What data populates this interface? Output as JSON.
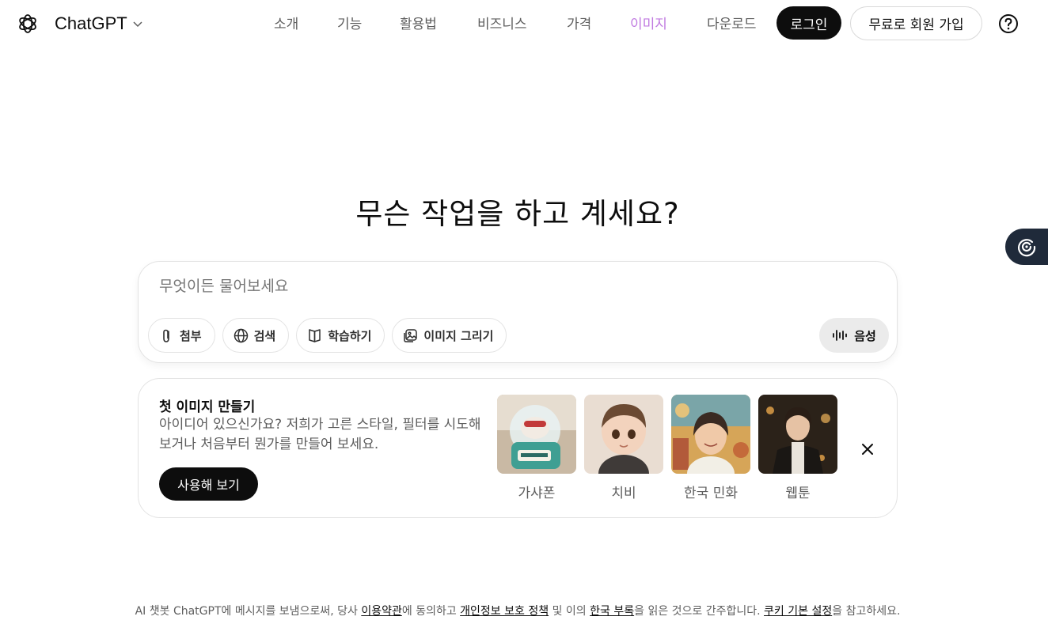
{
  "header": {
    "brand": "ChatGPT",
    "nav": [
      "소개",
      "기능",
      "활용법",
      "비즈니스",
      "가격",
      "이미지",
      "다운로드"
    ],
    "accent_color": "#c07ae0",
    "login": "로그인",
    "signup": "무료로 회원 가입",
    "help_icon": "question-circle-icon"
  },
  "main": {
    "headline": "무슨 작업을 하고 계세요?",
    "composer": {
      "placeholder": "무엇이든 물어보세요",
      "tools": [
        "첨부",
        "검색",
        "학습하기",
        "이미지 그리기"
      ],
      "voice": "음성"
    },
    "promo": {
      "title": "첫 이미지 만들기",
      "description": "아이디어 있으신가요? 저희가 고른 스타일, 필터를 시도해 보거나 처음부터 뭔가를 만들어 보세요.",
      "button": "사용해 보기",
      "styles": [
        "가샤폰",
        "치비",
        "한국 민화",
        "웹툰"
      ]
    }
  },
  "footer": {
    "prefix": "AI 챗봇 ChatGPT에 메시지를 보냄으로써, 당사 ",
    "terms": "이용약관",
    "mid1": "에 동의하고 ",
    "privacy": "개인정보 보호 정책",
    "mid2": " 및 이의 ",
    "addendum": "한국 부록",
    "mid3": "을 읽은 것으로 간주합니다. ",
    "cookies": "쿠키 기본 설정",
    "suffix": "을 참고하세요."
  }
}
